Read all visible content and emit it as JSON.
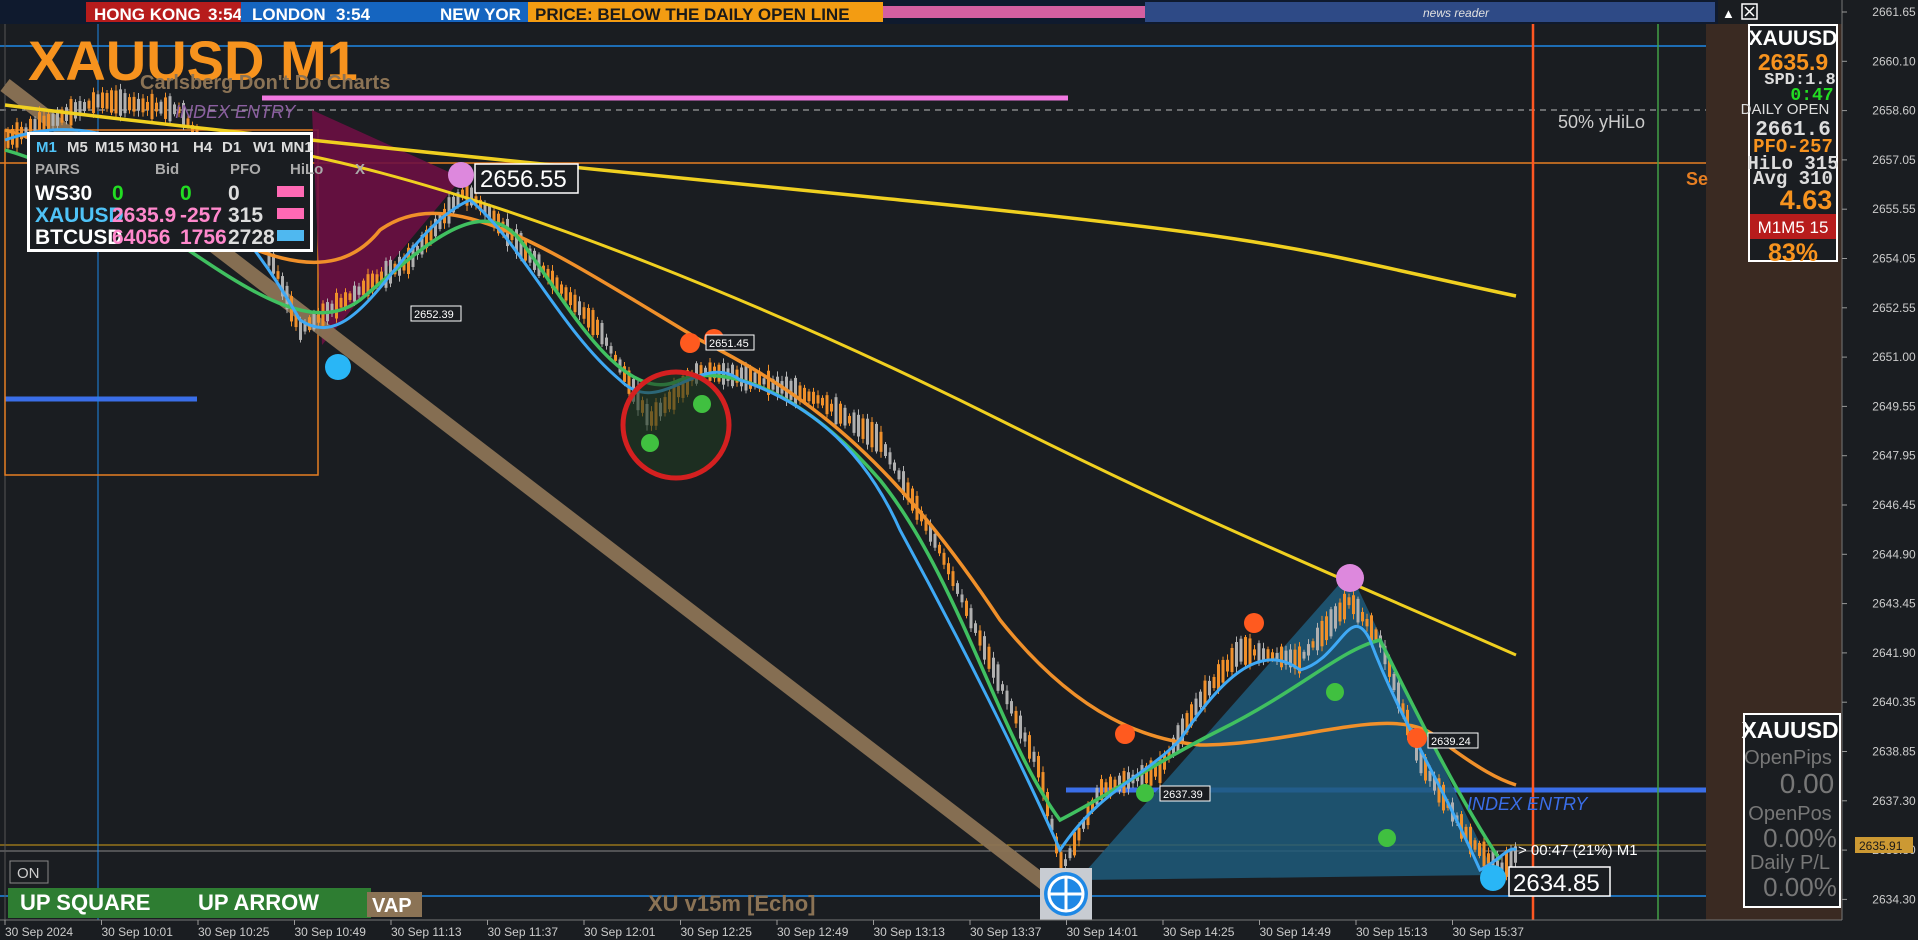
{
  "ticker_bar": {
    "hong_kong": "HONG KONG",
    "hong_kong_time": "3:54",
    "london": "LONDON",
    "london_time": "3:54",
    "new_york": "NEW YOR",
    "price_msg": "PRICE: BELOW THE DAILY OPEN LINE",
    "news_reader": "news reader",
    "colors": {
      "hk_bg": "#b71c1c",
      "london_bg": "#1565c0",
      "price_bg": "#f39c12",
      "news_bg": "#2e4a86"
    }
  },
  "header": {
    "title": "XAUUSD M1",
    "subtitle": "Carlsberg Don't Do Charts",
    "index_entry_top": "INDEX ENTRY"
  },
  "pairs_panel": {
    "timeframes": [
      "M1",
      "M5",
      "M15",
      "M30",
      "H1",
      "H4",
      "D1",
      "W1",
      "MN1"
    ],
    "headers": {
      "pairs": "PAIRS",
      "bid": "Bid",
      "pfo": "PFO",
      "hilo": "HiLo",
      "x": "X"
    },
    "rows": [
      {
        "name": "WS30",
        "bid": "0",
        "chg": "0",
        "hilo": "0",
        "color": "#ffffff",
        "bid_color": "#22dd22",
        "badge": "#ff69b4"
      },
      {
        "name": "XAUUSD",
        "bid": "2635.9",
        "chg": "-257",
        "hilo": "315",
        "color": "#4fc3f7",
        "bid_color": "#ff88cc",
        "badge": "#ff69b4"
      },
      {
        "name": "BTCUSD",
        "bid": "64056",
        "chg": "1756",
        "hilo": "2728",
        "color": "#ffffff",
        "bid_color": "#ff88cc",
        "badge": "#4fb8f0"
      }
    ]
  },
  "right_panel": {
    "symbol": "XAUUSD",
    "price": "2635.9",
    "spd": "SPD:1.8",
    "timer": "0:47",
    "daily_open_label": "DAILY OPEN",
    "daily_open": "2661.6",
    "pfo": "PFO-257",
    "hilo": "HiLo 315",
    "avg": "Avg 310",
    "ratio": "4.63",
    "tf_badge": "M1M5 15",
    "pct": "83%"
  },
  "bottom_panel": {
    "symbol": "XAUUSD",
    "open_pips_label": "OpenPips",
    "open_pips": "0.00",
    "open_pos_label": "OpenPos",
    "open_pos": "0.00%",
    "daily_pl_label": "Daily P/L",
    "daily_pl": "0.00%"
  },
  "annotations": {
    "high_price": "2656.55",
    "low_price": "2634.85",
    "label_2652": "2652.39",
    "label_2651": "2651.45",
    "label_2637": "2637.39",
    "label_2639": "2639.24",
    "yhilo": "50% yHiLo",
    "se": "Se",
    "index_entry": "INDEX ENTRY",
    "countdown": "> 00:47 (21%) M1",
    "price_tag": "2635.91",
    "echo_label": "XU v15m [Echo]",
    "on_btn": "ON",
    "up_square": "UP SQUARE",
    "up_arrow": "UP ARROW",
    "vap": "VAP"
  },
  "y_axis": {
    "ticks": [
      "2661.65",
      "2660.10",
      "2658.60",
      "2657.05",
      "2655.55",
      "2654.05",
      "2652.55",
      "2651.00",
      "2649.55",
      "2647.95",
      "2646.45",
      "2644.90",
      "2643.45",
      "2641.90",
      "2640.35",
      "2638.85",
      "2637.30",
      "2635.80",
      "2634.30"
    ]
  },
  "x_axis": {
    "ticks": [
      "30 Sep 2024",
      "30 Sep 10:01",
      "30 Sep 10:25",
      "30 Sep 10:49",
      "30 Sep 11:13",
      "30 Sep 11:37",
      "30 Sep 12:01",
      "30 Sep 12:25",
      "30 Sep 12:49",
      "30 Sep 13:13",
      "30 Sep 13:37",
      "30 Sep 14:01",
      "30 Sep 14:25",
      "30 Sep 14:49",
      "30 Sep 15:13",
      "30 Sep 15:37"
    ]
  }
}
